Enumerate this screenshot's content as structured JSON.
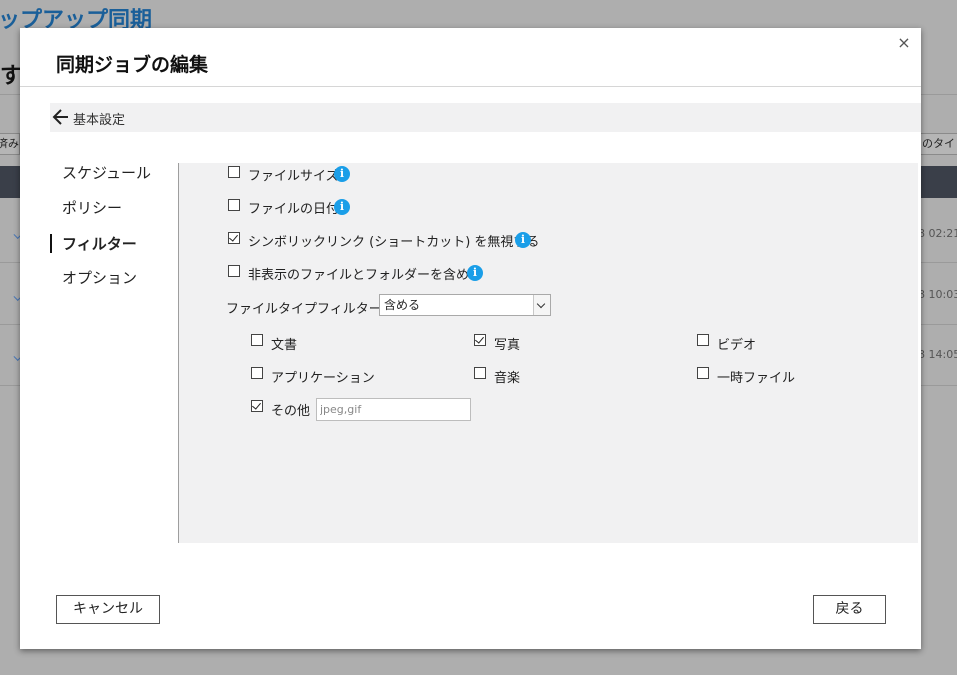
{
  "background": {
    "title": "ップアップ同期",
    "subtitle": "す",
    "left_pill": "済み",
    "right_pill": "のタイ",
    "times": [
      "8 02:21",
      "8 10:03",
      "8 14:05"
    ]
  },
  "dialog": {
    "title": "同期ジョブの編集",
    "close_glyph": "×",
    "breadcrumb": "基本設定",
    "nav": [
      {
        "label": "スケジュール",
        "active": false
      },
      {
        "label": "ポリシー",
        "active": false
      },
      {
        "label": "フィルター",
        "active": true
      },
      {
        "label": "オプション",
        "active": false
      }
    ],
    "filters": {
      "file_size": {
        "label": "ファイルサイズ",
        "checked": false
      },
      "file_date": {
        "label": "ファイルの日付",
        "checked": false
      },
      "ignore_symlinks": {
        "label": "シンボリックリンク (ショートカット) を無視する",
        "checked": true
      },
      "include_hidden": {
        "label": "非表示のファイルとフォルダーを含める",
        "checked": false
      },
      "info_glyph": "i"
    },
    "file_type_filter": {
      "label": "ファイルタイプフィルター:",
      "selected": "含める",
      "types": {
        "documents": {
          "label": "文書",
          "checked": false
        },
        "photos": {
          "label": "写真",
          "checked": true
        },
        "videos": {
          "label": "ビデオ",
          "checked": false
        },
        "applications": {
          "label": "アプリケーション",
          "checked": false
        },
        "music": {
          "label": "音楽",
          "checked": false
        },
        "temp_files": {
          "label": "一時ファイル",
          "checked": false
        },
        "other": {
          "label": "その他",
          "checked": true
        }
      },
      "other_value": "jpeg,gif"
    },
    "buttons": {
      "cancel": "キャンセル",
      "back": "戻る"
    }
  },
  "colors": {
    "info_blue": "#1a9ee8",
    "background_title": "#1a5f99",
    "dark_header": "#3a3f49"
  }
}
